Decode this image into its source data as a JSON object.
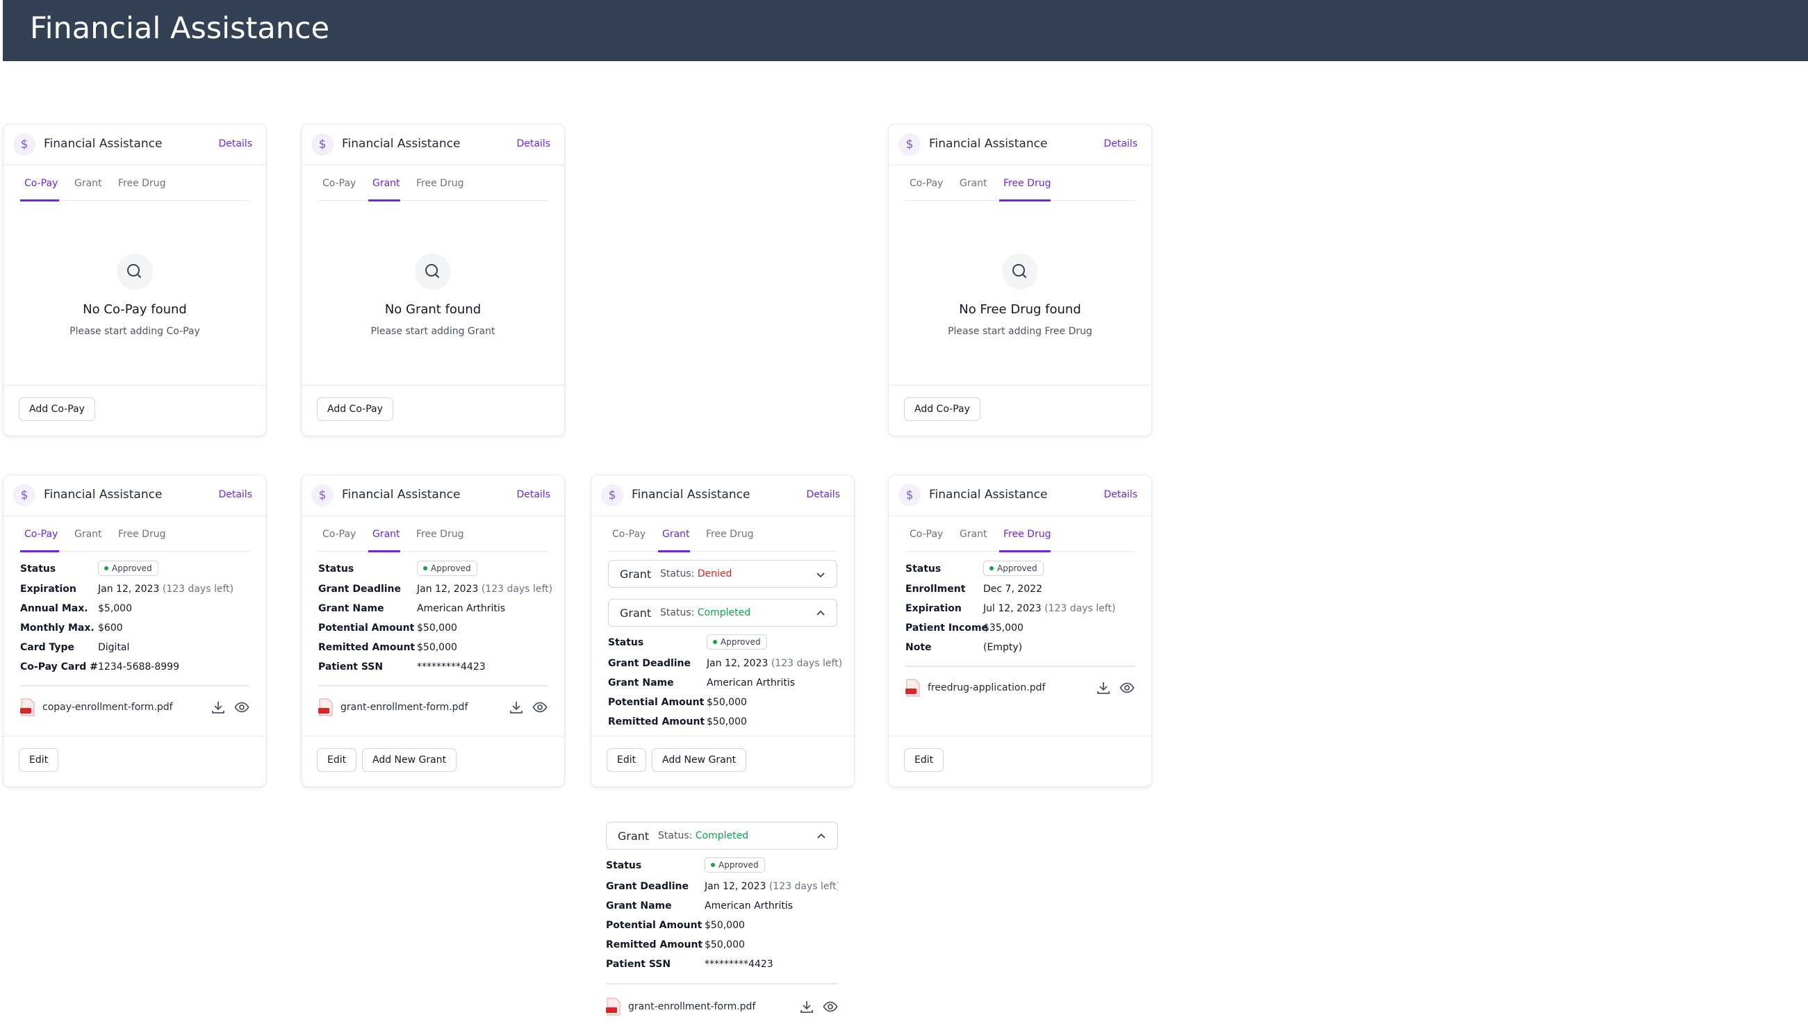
{
  "header": {
    "title": "Financial Assistance"
  },
  "common": {
    "card_title": "Financial Assistance",
    "details": "Details",
    "tabs": [
      "Co-Pay",
      "Grant",
      "Free Drug"
    ],
    "add_copay": "Add Co-Pay",
    "edit": "Edit",
    "add_new_grant": "Add New Grant",
    "approved": "Approved",
    "grant_label": "Grant",
    "status_prefix": "Status:",
    "denied": "Denied",
    "completed": "Completed"
  },
  "empty": {
    "copay": {
      "title": "No Co-Pay found",
      "subtitle": "Please start adding Co-Pay"
    },
    "grant": {
      "title": "No Grant found",
      "subtitle": "Please start adding Grant"
    },
    "freedrug": {
      "title": "No Free Drug found",
      "subtitle": "Please start adding Free Drug"
    }
  },
  "copay_details": {
    "labels": [
      "Status",
      "Expiration",
      "Annual Max.",
      "Monthly Max.",
      "Card Type",
      "Co-Pay Card #"
    ],
    "expiration": "Jan 12, 2023",
    "days_left": "(123 days left)",
    "annual_max": "$5,000",
    "monthly_max": "$600",
    "card_type": "Digital",
    "card_number": "1234-5688-8999",
    "file": "copay-enrollment-form.pdf"
  },
  "grant_details": {
    "labels": [
      "Status",
      "Grant Deadline",
      "Grant Name",
      "Potential Amount",
      "Remitted Amount",
      "Patient SSN"
    ],
    "deadline": "Jan 12, 2023",
    "days_left": "(123 days left)",
    "name": "American Arthritis",
    "potential": "$50,000",
    "remitted": "$50,000",
    "ssn": "*********4423",
    "file": "grant-enrollment-form.pdf"
  },
  "freedrug_details": {
    "labels": [
      "Status",
      "Enrollment",
      "Expiration",
      "Patient Income",
      "Note"
    ],
    "enrollment": "Dec 7, 2022",
    "expiration": "Jul 12, 2023",
    "days_left": "(123 days left)",
    "income": "$35,000",
    "note": "(Empty)",
    "file": "freedrug-application.pdf"
  }
}
